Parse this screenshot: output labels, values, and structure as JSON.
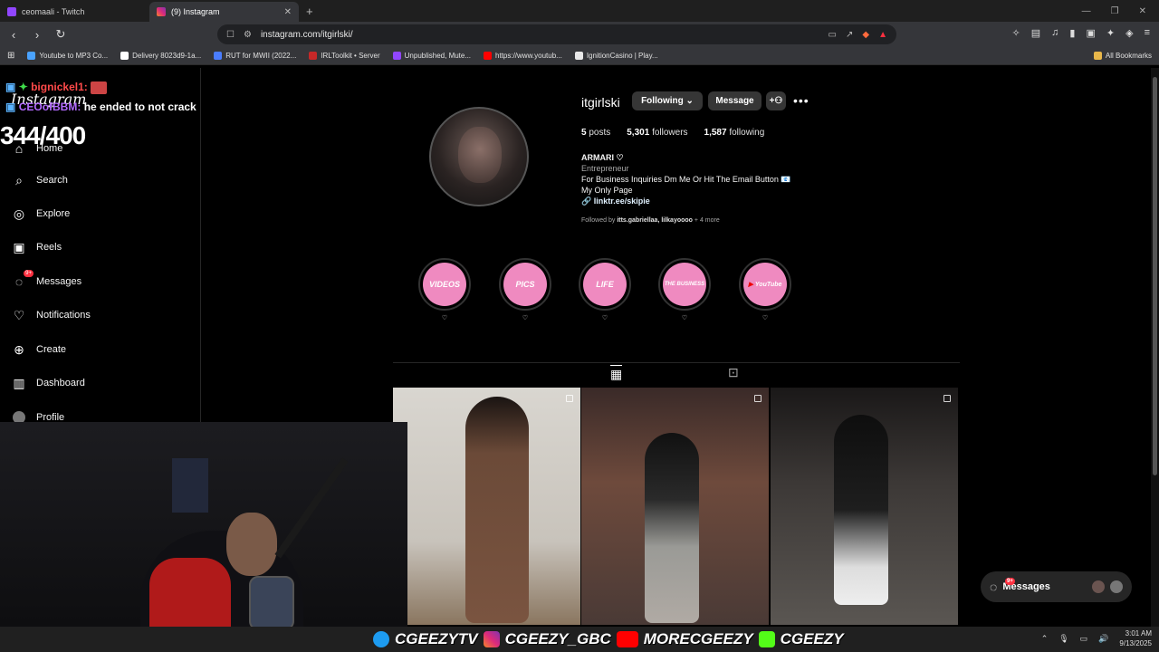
{
  "tabs": [
    {
      "title": "ceomaali - Twitch",
      "active": false
    },
    {
      "title": "(9) Instagram",
      "active": true
    }
  ],
  "address": {
    "url": "instagram.com/itgirlski/"
  },
  "bookmarks": [
    "Youtube to MP3 Co...",
    "Delivery 8023d9-1a...",
    "RUT for MWII (2022...",
    "IRLToolkit • Server",
    "Unpublished, Mute...",
    "https://www.youtub...",
    "IgnitionCasino | Play..."
  ],
  "bookmarks_all": "All Bookmarks",
  "overlay": {
    "chat_user1": "bignickel1:",
    "chat_user2": "CEOofBBM:",
    "chat_msg2": "he ended to not crack",
    "counter": "344/400",
    "ig_logo": "Instagram"
  },
  "sidebar": {
    "items": [
      {
        "label": "Home"
      },
      {
        "label": "Search"
      },
      {
        "label": "Explore"
      },
      {
        "label": "Reels"
      },
      {
        "label": "Messages",
        "badge": "9+"
      },
      {
        "label": "Notifications"
      },
      {
        "label": "Create"
      },
      {
        "label": "Dashboard"
      },
      {
        "label": "Profile"
      }
    ]
  },
  "profile": {
    "username": "itgirlski",
    "following_btn": "Following",
    "message_btn": "Message",
    "posts_count": "5",
    "posts_label": "posts",
    "followers_count": "5,301",
    "followers_label": "followers",
    "following_count": "1,587",
    "following_label": "following",
    "name": "ARMARI ♡",
    "category": "Entrepreneur",
    "bio_line1": "For Business Inquiries Dm Me Or Hit The Email Button 📧",
    "bio_line2": "My Only Page",
    "link": "linktr.ee/skipie",
    "followed_prefix": "Followed by",
    "followed_names": "itts.gabriellaa, lilkayoooo",
    "followed_suffix": "+ 4 more"
  },
  "highlights": [
    {
      "label": "VIDEOS",
      "caption": "♡"
    },
    {
      "label": "PICS",
      "caption": "♡"
    },
    {
      "label": "LIFE",
      "caption": "♡"
    },
    {
      "label": "THE BUSINESS",
      "caption": "♡"
    },
    {
      "label": "YouTube",
      "caption": "♡"
    }
  ],
  "messages_bar": {
    "label": "Messages",
    "badge": "9+"
  },
  "socials": {
    "twitter": "CGEEZYTV",
    "instagram": "CGEEZY_GBC",
    "youtube": "MORECGEEZY",
    "kick": "CGEEZY"
  },
  "clock": {
    "time": "3:01 AM",
    "date": "9/13/2025"
  },
  "colors": {
    "accent": "#0095f6",
    "badge": "#ff3040",
    "highlight_pink": "#ef8ac0"
  }
}
